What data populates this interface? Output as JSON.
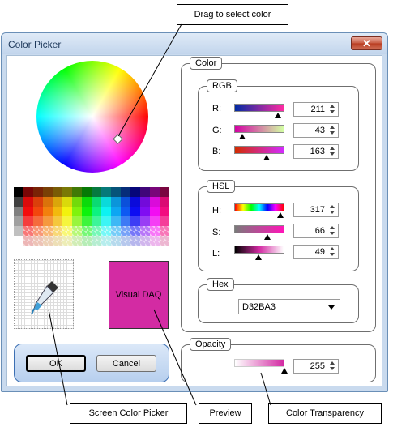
{
  "callouts": {
    "drag": "Drag to select color",
    "screen_picker": "Screen Color Picker",
    "preview": "Preview",
    "transparency": "Color Transparency"
  },
  "window": {
    "title": "Color Picker",
    "close_glyph": "✕"
  },
  "preview": {
    "label": "Visual DAQ",
    "color": "#d32ba3"
  },
  "buttons": {
    "ok": "OK",
    "cancel": "Cancel"
  },
  "color_group": {
    "legend": "Color",
    "rgb": {
      "legend": "RGB",
      "rows": [
        {
          "label": "R:",
          "value": "211"
        },
        {
          "label": "G:",
          "value": "43"
        },
        {
          "label": "B:",
          "value": "163"
        }
      ]
    },
    "hsl": {
      "legend": "HSL",
      "rows": [
        {
          "label": "H:",
          "value": "317"
        },
        {
          "label": "S:",
          "value": "66"
        },
        {
          "label": "L:",
          "value": "49"
        }
      ]
    },
    "hex": {
      "legend": "Hex",
      "value": "D32BA3"
    }
  },
  "opacity": {
    "legend": "Opacity",
    "value": "255"
  },
  "icons": [
    "close-icon",
    "eyedropper-icon",
    "chevron-down-icon",
    "spin-up-icon",
    "spin-down-icon"
  ]
}
